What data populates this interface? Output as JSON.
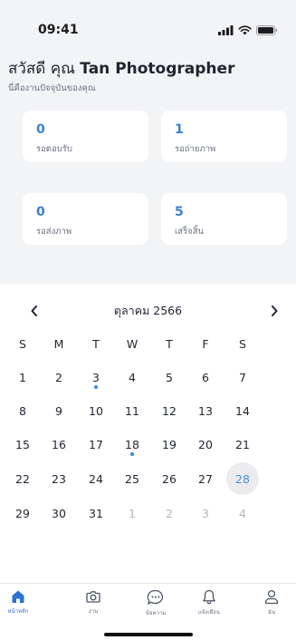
{
  "status_bar": {
    "time": "09:41"
  },
  "header": {
    "greeting_prefix": "สวัสดี คุณ",
    "name": "Tan Photographer",
    "subtitle": "นี่คืองานปัจจุบันของคุณ"
  },
  "stats": [
    {
      "value": "0",
      "label": "รอตอบรับ"
    },
    {
      "value": "1",
      "label": "รอถ่ายภาพ"
    },
    {
      "value": "0",
      "label": "รอส่งภาพ"
    },
    {
      "value": "5",
      "label": "เสร็จสิ้น"
    }
  ],
  "calendar": {
    "month_label": "ตุลาคม 2566",
    "weekdays": [
      "S",
      "M",
      "T",
      "W",
      "T",
      "F",
      "S"
    ],
    "weeks": [
      [
        {
          "d": "1"
        },
        {
          "d": "2"
        },
        {
          "d": "3",
          "event": true
        },
        {
          "d": "4"
        },
        {
          "d": "5"
        },
        {
          "d": "6"
        },
        {
          "d": "7"
        }
      ],
      [
        {
          "d": "8"
        },
        {
          "d": "9"
        },
        {
          "d": "10"
        },
        {
          "d": "11"
        },
        {
          "d": "12"
        },
        {
          "d": "13"
        },
        {
          "d": "14"
        }
      ],
      [
        {
          "d": "15"
        },
        {
          "d": "16"
        },
        {
          "d": "17"
        },
        {
          "d": "18",
          "event": true
        },
        {
          "d": "19"
        },
        {
          "d": "20"
        },
        {
          "d": "21"
        }
      ],
      [
        {
          "d": "22"
        },
        {
          "d": "23"
        },
        {
          "d": "24"
        },
        {
          "d": "25"
        },
        {
          "d": "26"
        },
        {
          "d": "27"
        },
        {
          "d": "28",
          "today": true
        }
      ],
      [
        {
          "d": "29"
        },
        {
          "d": "30"
        },
        {
          "d": "31"
        },
        {
          "d": "1",
          "muted": true
        },
        {
          "d": "2",
          "muted": true
        },
        {
          "d": "3",
          "muted": true
        },
        {
          "d": "4",
          "muted": true
        }
      ]
    ]
  },
  "tab_bar": {
    "items": [
      {
        "label": "หน้าหลัก",
        "icon": "home-icon",
        "active": true
      },
      {
        "label": "งาน",
        "icon": "camera-icon",
        "active": false
      },
      {
        "label": "ข้อความ",
        "icon": "chat-icon",
        "active": false
      },
      {
        "label": "แจ้งเตือน",
        "icon": "bell-icon",
        "active": false
      },
      {
        "label": "ฉัน",
        "icon": "user-icon",
        "active": false
      }
    ]
  },
  "colors": {
    "accent": "#3a7fd6",
    "background": "#f3f4f6",
    "today_highlight": "#ececef"
  }
}
